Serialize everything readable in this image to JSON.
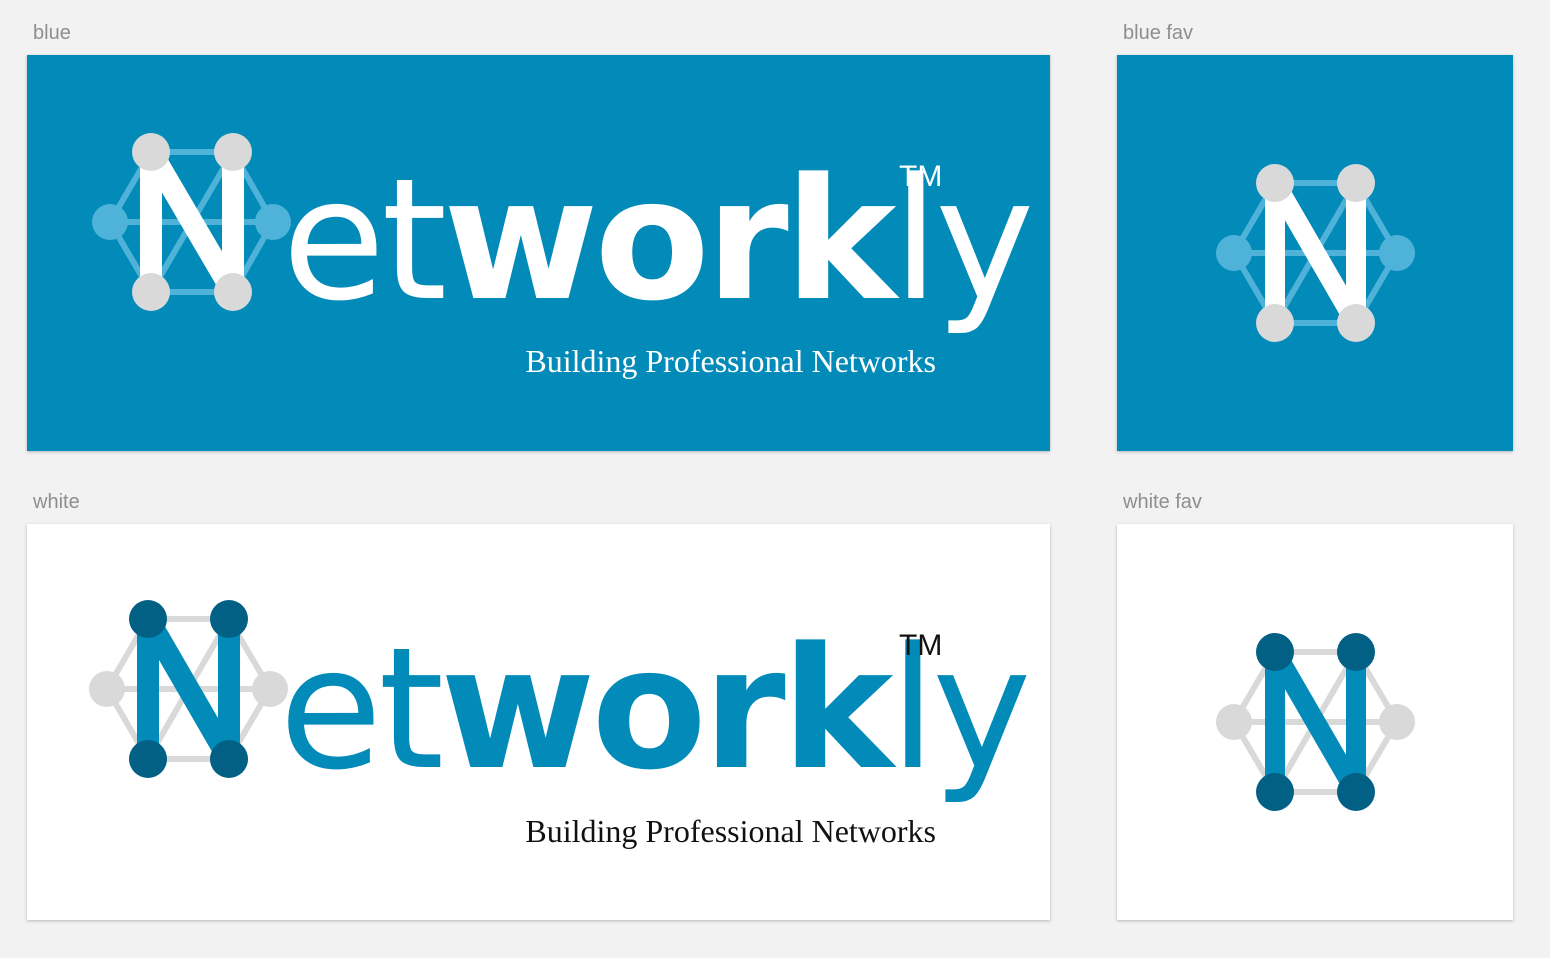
{
  "artboards": {
    "blue": {
      "label": "blue",
      "color": "#028bb8"
    },
    "blue_fav": {
      "label": "blue fav",
      "color": "#028bb8"
    },
    "white": {
      "label": "white",
      "color": "#ffffff"
    },
    "white_fav": {
      "label": "white fav",
      "color": "#ffffff"
    }
  },
  "logo": {
    "word_part_regular": "et",
    "word_part_bold": "work",
    "word_part_end": "ly",
    "trademark": "TM",
    "tagline": "Building Professional Networks"
  },
  "colors": {
    "brand_blue": "#028bb8",
    "dark_blue_node": "#026085",
    "light_blue_node": "#4fb3d9",
    "grey_node": "#d9d9d9",
    "white": "#ffffff",
    "black": "#111111"
  },
  "icons": [
    "network-n-icon"
  ]
}
